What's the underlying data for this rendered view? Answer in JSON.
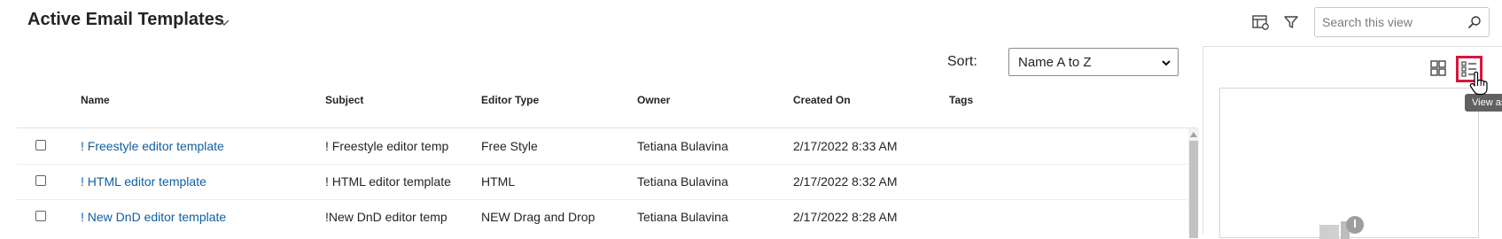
{
  "header": {
    "view_title": "Active Email Templates",
    "search_placeholder": "Search this view"
  },
  "sort": {
    "label": "Sort:",
    "selected": "Name A to Z"
  },
  "grid": {
    "columns": [
      "Name",
      "Subject",
      "Editor Type",
      "Owner",
      "Created On",
      "Tags"
    ],
    "rows": [
      {
        "name": "! Freestyle editor template",
        "subject": "! Freestyle editor temp",
        "editor_type": "Free Style",
        "owner": "Tetiana Bulavina",
        "created_on": "2/17/2022 8:33 AM",
        "tags": ""
      },
      {
        "name": "! HTML editor template",
        "subject": "! HTML editor template",
        "editor_type": "HTML",
        "owner": "Tetiana Bulavina",
        "created_on": "2/17/2022 8:32 AM",
        "tags": ""
      },
      {
        "name": "! New DnD editor template",
        "subject": "!New DnD editor temp",
        "editor_type": "NEW Drag and Drop",
        "owner": "Tetiana Bulavina",
        "created_on": "2/17/2022 8:28 AM",
        "tags": ""
      }
    ]
  },
  "panel": {
    "tooltip": "View as List"
  },
  "colors": {
    "link": "#115ea3",
    "highlight": "#d6173e",
    "tooltip_bg": "#616161"
  },
  "icons": [
    "chevron-down-icon",
    "column-settings-icon",
    "filter-icon",
    "search-icon",
    "grid-view-icon",
    "list-view-icon",
    "pointer-cursor-icon"
  ]
}
